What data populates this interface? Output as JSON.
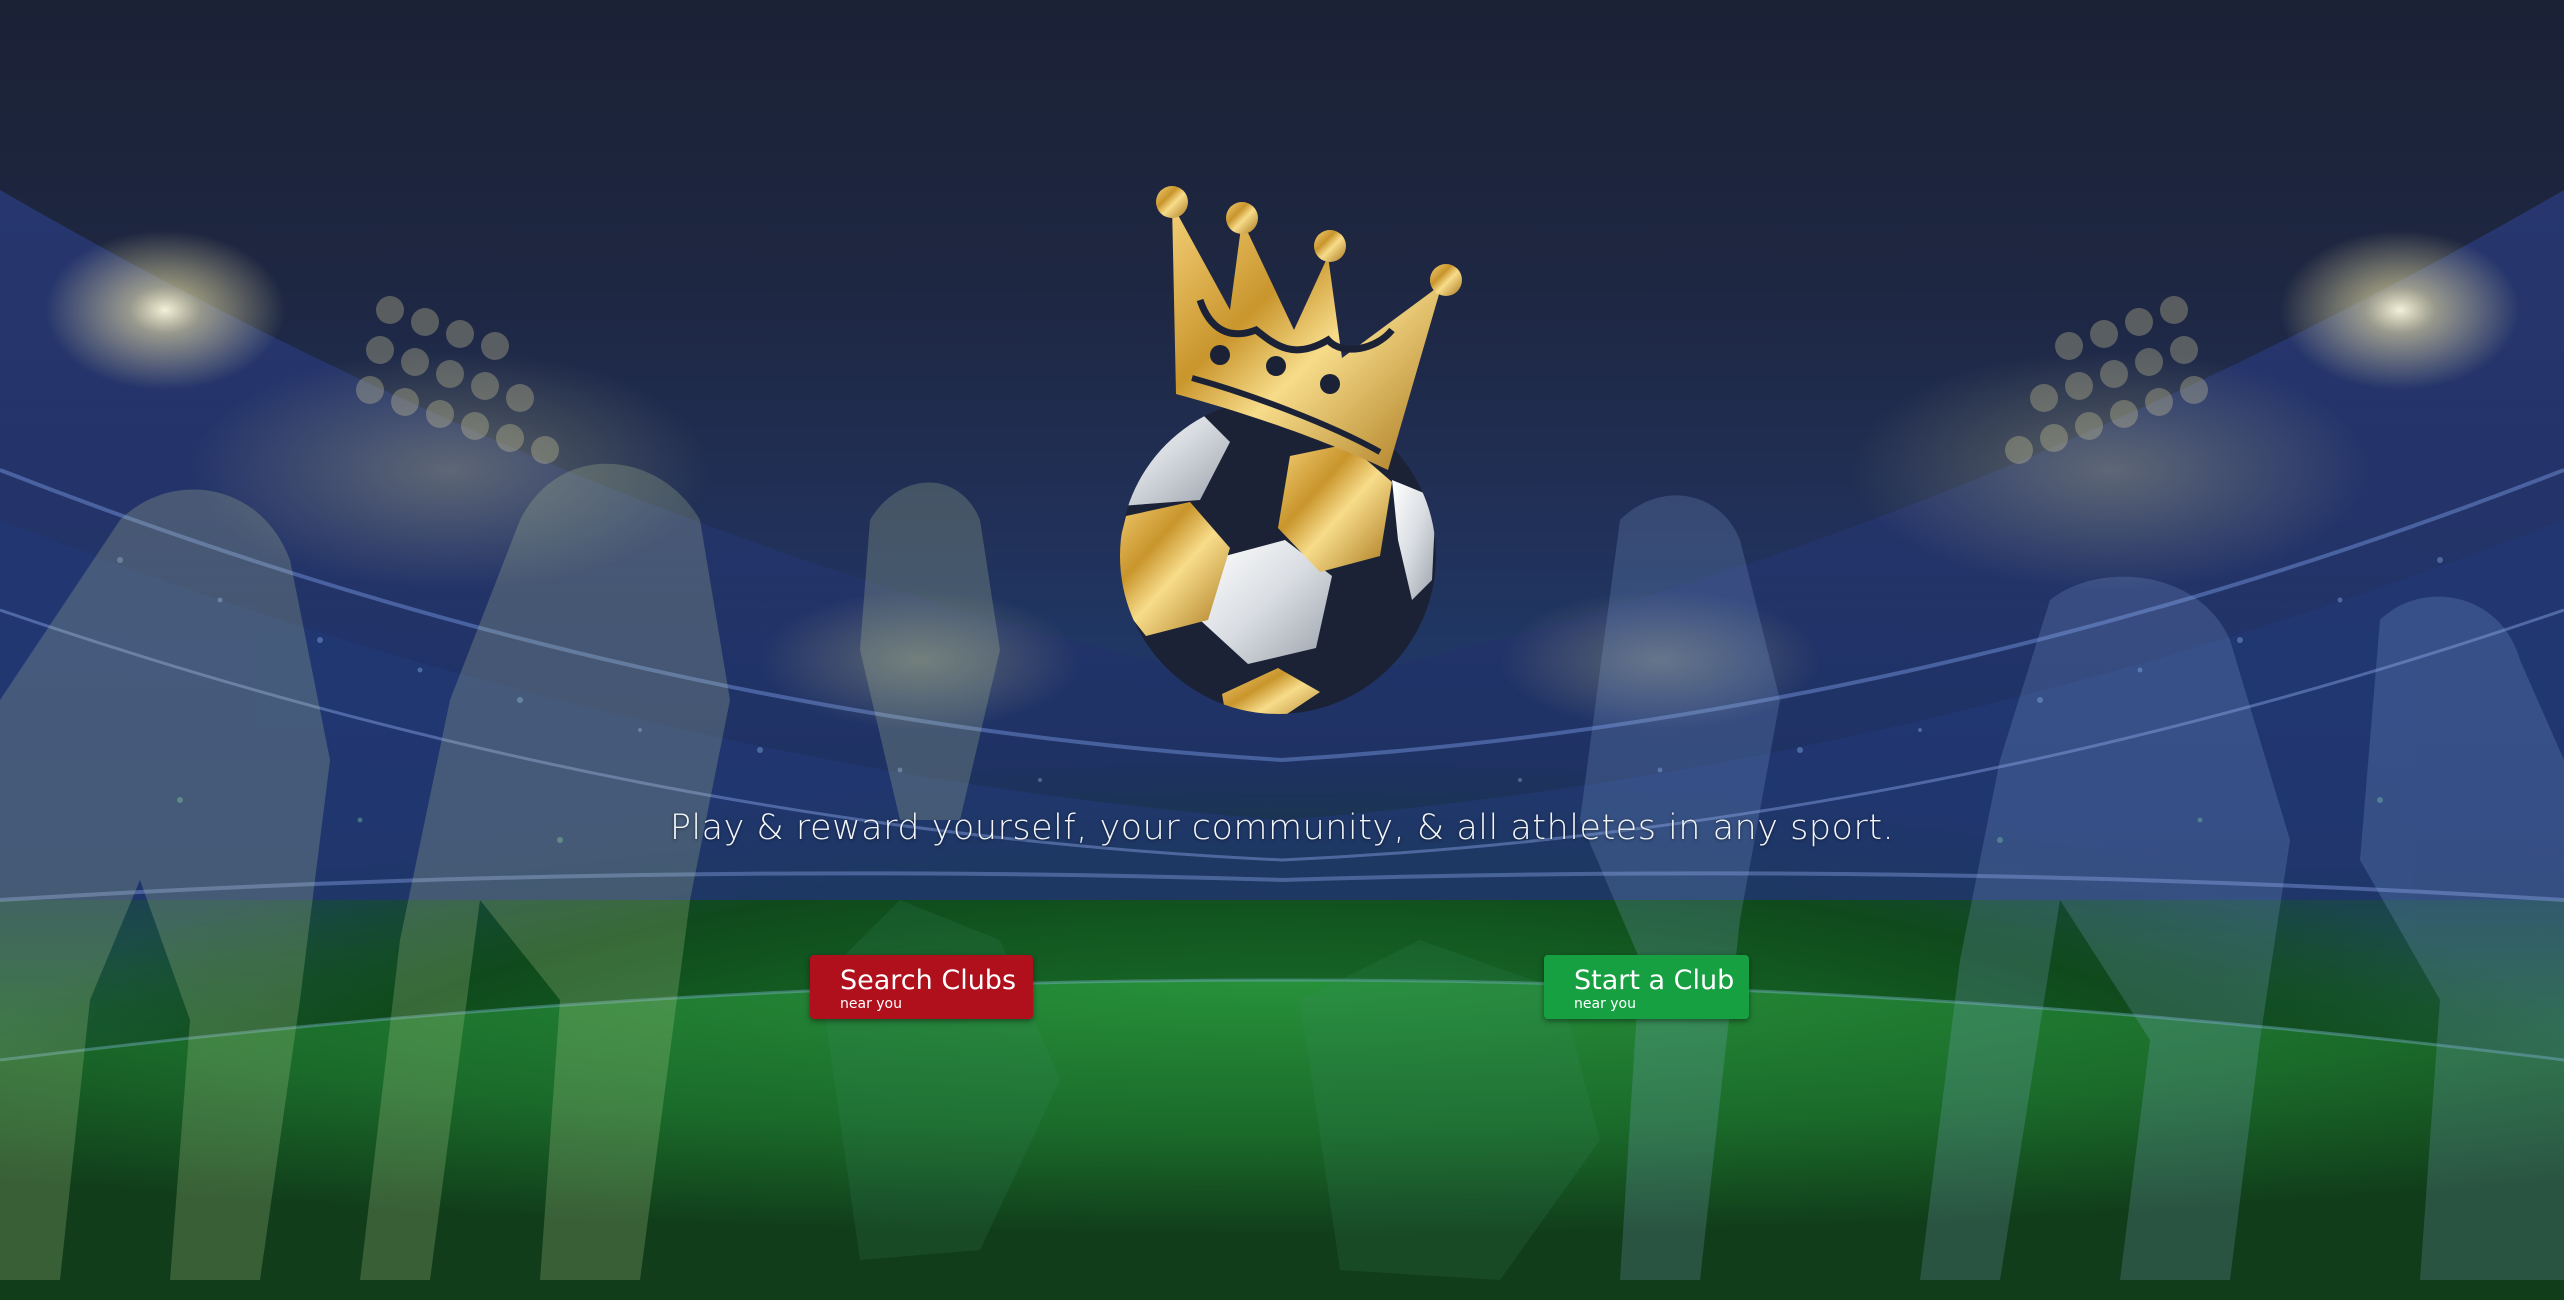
{
  "hero": {
    "logo_icon": "crowned-soccer-ball-icon",
    "tagline": "Play & reward yourself, your community, & all athletes in any sport."
  },
  "actions": {
    "search_clubs": {
      "label": "Search Clubs",
      "sublabel": "near you",
      "color": "#b0101c"
    },
    "start_club": {
      "label": "Start a Club",
      "sublabel": "near you",
      "color": "#17a042"
    }
  },
  "colors": {
    "gold": "#d4a437",
    "night_sky": "#1b2236",
    "pitch_green": "#1b6b2a"
  }
}
